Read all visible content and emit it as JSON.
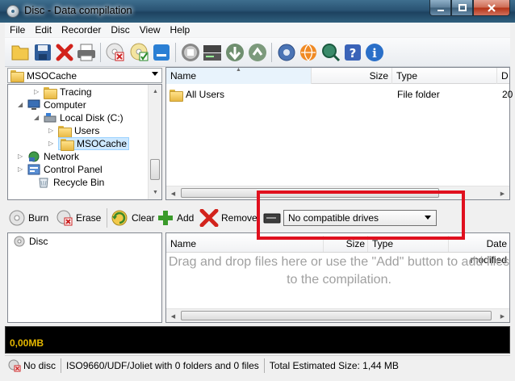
{
  "window": {
    "title": "Disc - Data compilation"
  },
  "menu": [
    "File",
    "Edit",
    "Recorder",
    "Disc",
    "View",
    "Help"
  ],
  "toolbar_icons": [
    "new-icon",
    "save-icon",
    "delete-icon",
    "print-icon",
    "erase-disc-icon",
    "burn-disc-icon",
    "blue-square-icon",
    "rip-icon",
    "drive-icon",
    "refresh-icon",
    "update-icon",
    "settings-icon",
    "web-icon",
    "search-icon",
    "help-icon",
    "info-icon"
  ],
  "folder_combo": {
    "value": "MSOCache"
  },
  "tree": [
    {
      "label": "Tracing",
      "icon": "folder-icon",
      "expander": "▷"
    },
    {
      "label": "Computer",
      "icon": "computer-icon",
      "expander": "◢"
    },
    {
      "label": "Local Disk (C:)",
      "icon": "drive-icon",
      "expander": "◢"
    },
    {
      "label": "Users",
      "icon": "folder-icon",
      "expander": "▷"
    },
    {
      "label": "MSOCache",
      "icon": "folder-icon",
      "expander": "▷"
    },
    {
      "label": "Network",
      "icon": "network-icon",
      "expander": "▷"
    },
    {
      "label": "Control Panel",
      "icon": "control-panel-icon",
      "expander": "▷"
    },
    {
      "label": "Recycle Bin",
      "icon": "recycle-bin-icon",
      "expander": ""
    }
  ],
  "file_list": {
    "columns": [
      "Name",
      "Size",
      "Type",
      "D"
    ],
    "rows": [
      {
        "name": "All Users",
        "size": "",
        "type": "File folder",
        "date": "20"
      }
    ]
  },
  "actions": {
    "burn": "Burn",
    "erase": "Erase",
    "clear": "Clear",
    "add": "Add",
    "remove": "Remove"
  },
  "drive_select": {
    "value": "No compatible drives"
  },
  "compilation_tree": {
    "root": "Disc"
  },
  "compilation_list": {
    "columns": [
      "Name",
      "Size",
      "Type",
      "Date modified"
    ],
    "empty_message": "Drag and drop files here or use the \"Add\" button to add files to the compilation."
  },
  "capacity": {
    "used": "0,00MB"
  },
  "status": {
    "disc": "No disc",
    "filesystem": "ISO9660/UDF/Joliet with 0 folders and 0 files",
    "total": "Total Estimated Size: 1,44 MB"
  },
  "colors": {
    "highlight": "#e0101e",
    "capacity_text": "#e6b800",
    "selection": "#cde8ff"
  }
}
